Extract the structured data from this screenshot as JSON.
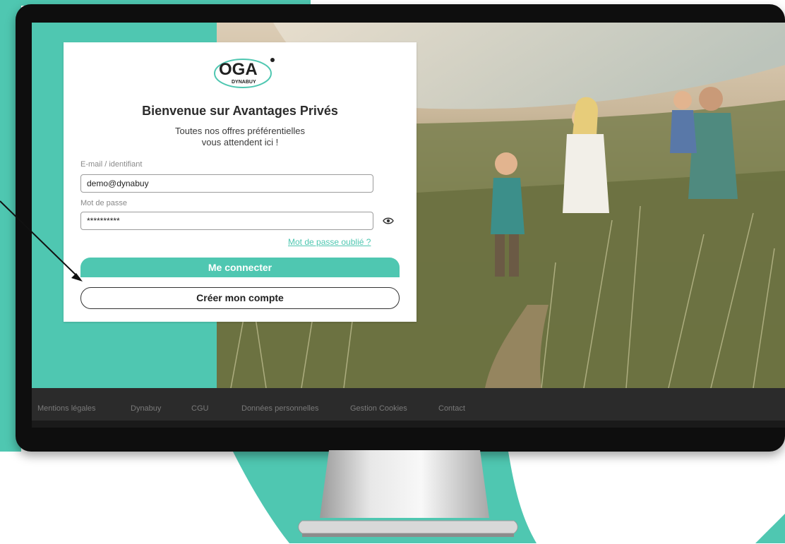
{
  "colors": {
    "accent": "#4fc7b1",
    "footer_bg": "#2b2b2b",
    "footer_text": "#7a7a7a",
    "bezel": "#0e0e0e"
  },
  "login": {
    "logo_text": "OGA",
    "logo_subtext": "DYNABUY",
    "title": "Bienvenue sur Avantages Privés",
    "subtitle_line1": "Toutes nos offres préférentielles",
    "subtitle_line2": "vous attendent ici !",
    "email_label": "E-mail / identifiant",
    "email_value": "demo@dynabuy",
    "password_label": "Mot de passe",
    "password_value": "**********",
    "show_password_icon": "eye-icon",
    "forgot_password": "Mot de passe oublié ?",
    "login_button": "Me connecter",
    "create_account_button": "Créer mon compte"
  },
  "footer": {
    "links": [
      "Mentions légales",
      "Dynabuy",
      "CGU",
      "Données personnelles",
      "Gestion Cookies",
      "Contact"
    ]
  },
  "annotation": {
    "arrow_icon": "arrow-icon"
  }
}
